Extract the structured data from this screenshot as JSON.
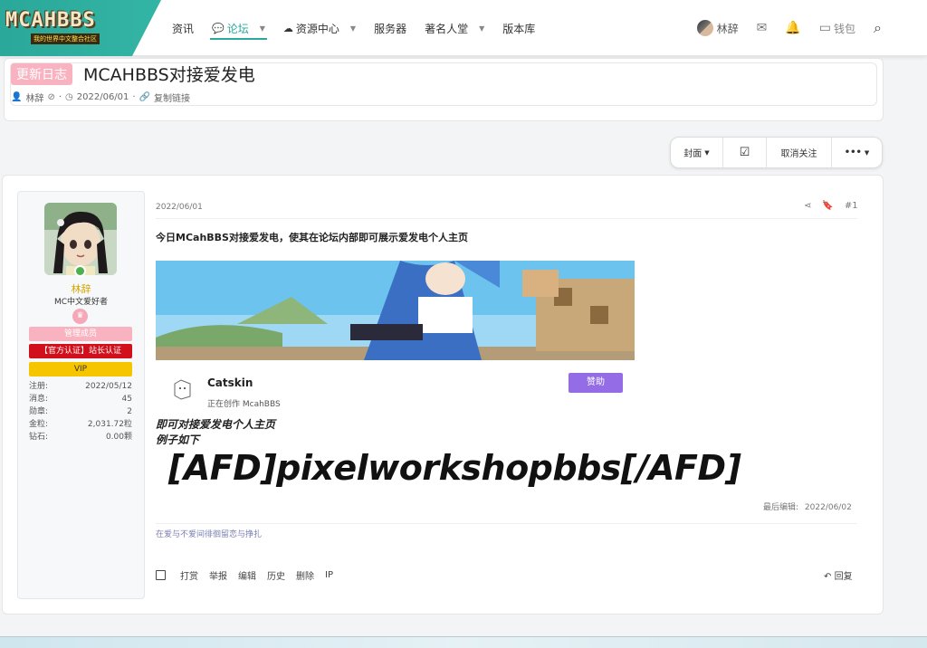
{
  "logo": {
    "text": "MCAHBBS",
    "subtitle": "我的世界中文整合社区"
  },
  "nav": {
    "items": [
      {
        "label": "资讯"
      },
      {
        "label": "论坛"
      },
      {
        "label": "资源中心"
      },
      {
        "label": "服务器"
      },
      {
        "label": "著名人堂"
      },
      {
        "label": "版本库"
      }
    ]
  },
  "userbar": {
    "username": "林辞",
    "wallet": "钱包"
  },
  "thread": {
    "prefix": "更新日志",
    "title": "MCAHBBS对接爱发电",
    "author": "林辞",
    "date": "2022/06/01",
    "copy_link": "复制链接"
  },
  "actions": {
    "cover": "封面",
    "unfollow": "取消关注",
    "more": "•••"
  },
  "user_card": {
    "name": "林辞",
    "title": "MC中文爱好者",
    "roles": [
      "管理成员",
      "【官方认证】站长认证",
      "VIP"
    ],
    "stats": [
      {
        "label": "注册:",
        "value": "2022/05/12"
      },
      {
        "label": "消息:",
        "value": "45"
      },
      {
        "label": "勋章:",
        "value": "2"
      },
      {
        "label": "金粒:",
        "value": "2,031.72粒"
      },
      {
        "label": "钻石:",
        "value": "0.00颗"
      }
    ]
  },
  "post": {
    "date": "2022/06/01",
    "number": "#1",
    "lead": "今日MCahBBS对接爱发电，使其在论坛内部即可展示爱发电个人主页",
    "afdian": {
      "name": "Catskin",
      "desc": "正在创作 McahBBS",
      "button": "赞助"
    },
    "line1": "即可对接爱发电个人主页",
    "line2": "例子如下",
    "code": "[AFD]pixelworkshopbbs[/AFD]",
    "last_edit_label": "最后编辑:",
    "last_edit_date": "2022/06/02",
    "signature": "在爱与不爱间徘徊留恋与挣扎",
    "footer": {
      "tip": "打赏",
      "report": "举报",
      "edit": "编辑",
      "history": "历史",
      "delete": "删除",
      "ip": "IP",
      "reply": "回复"
    }
  }
}
